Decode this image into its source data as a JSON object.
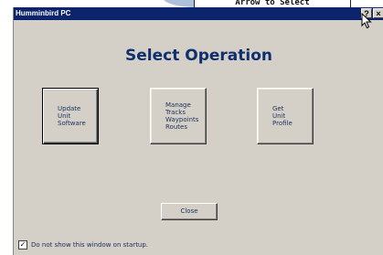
{
  "background_hint": "Arrow to Select",
  "window": {
    "title": "Humminbird PC",
    "help_glyph": "?",
    "close_glyph": "×"
  },
  "heading": "Select Operation",
  "operations": [
    {
      "lines": [
        "Update",
        "Unit",
        "Software"
      ]
    },
    {
      "lines": [
        "Manage",
        "Tracks",
        "Waypoints",
        "Routes"
      ]
    },
    {
      "lines": [
        "Get",
        "Unit",
        "Profile"
      ]
    }
  ],
  "close_label": "Close",
  "startup_checkbox": {
    "label": "Do not show this window on startup.",
    "checked": true,
    "check_glyph": "✓"
  },
  "colors": {
    "titlebar": "#0b246b",
    "face": "#d4d0c8",
    "text": "#1a2f5a",
    "heading": "#0f2f6e"
  }
}
